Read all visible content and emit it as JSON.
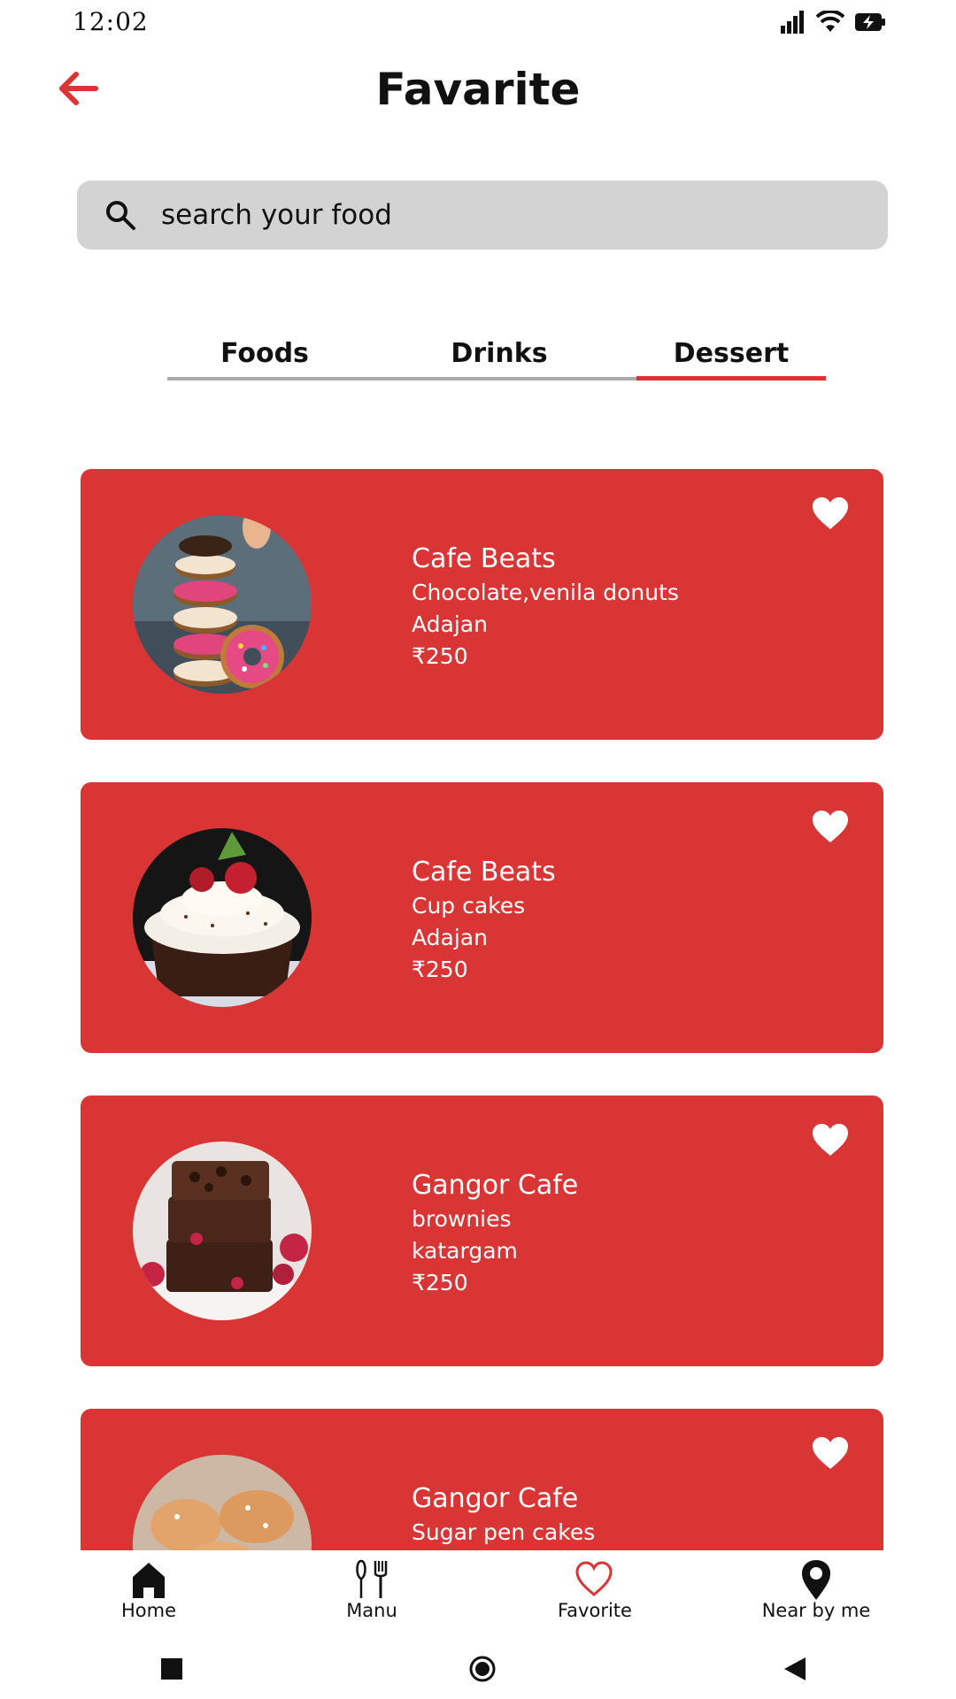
{
  "status_bar": {
    "time": "12:02"
  },
  "header": {
    "title": "Favarite"
  },
  "search": {
    "placeholder": "search your food"
  },
  "tabs": [
    {
      "label": "Foods",
      "active": false
    },
    {
      "label": "Drinks",
      "active": false
    },
    {
      "label": "Dessert",
      "active": true
    }
  ],
  "cards": [
    {
      "name": "Cafe Beats",
      "item": "Chocolate,venila donuts",
      "location": "Adajan",
      "price": "₹250",
      "image": "donuts-photo",
      "favorite": true
    },
    {
      "name": "Cafe Beats",
      "item": "Cup cakes",
      "location": "Adajan",
      "price": "₹250",
      "image": "cupcake-photo",
      "favorite": true
    },
    {
      "name": "Gangor Cafe",
      "item": "brownies",
      "location": "katargam",
      "price": "₹250",
      "image": "brownie-photo",
      "favorite": true
    },
    {
      "name": "Gangor Cafe",
      "item": "Sugar pen cakes",
      "location": "",
      "price": "",
      "image": "sugar-cakes-photo",
      "favorite": true
    }
  ],
  "bottom_nav": [
    {
      "label": "Home",
      "icon": "home-icon"
    },
    {
      "label": "Manu",
      "icon": "fork-knife-icon"
    },
    {
      "label": "Favorite",
      "icon": "heart-outline-icon"
    },
    {
      "label": "Near by me",
      "icon": "location-pin-icon"
    }
  ],
  "colors": {
    "accent": "#d93535",
    "search_bg": "#d3d3d3",
    "tab_inactive": "#aaaaaa"
  }
}
